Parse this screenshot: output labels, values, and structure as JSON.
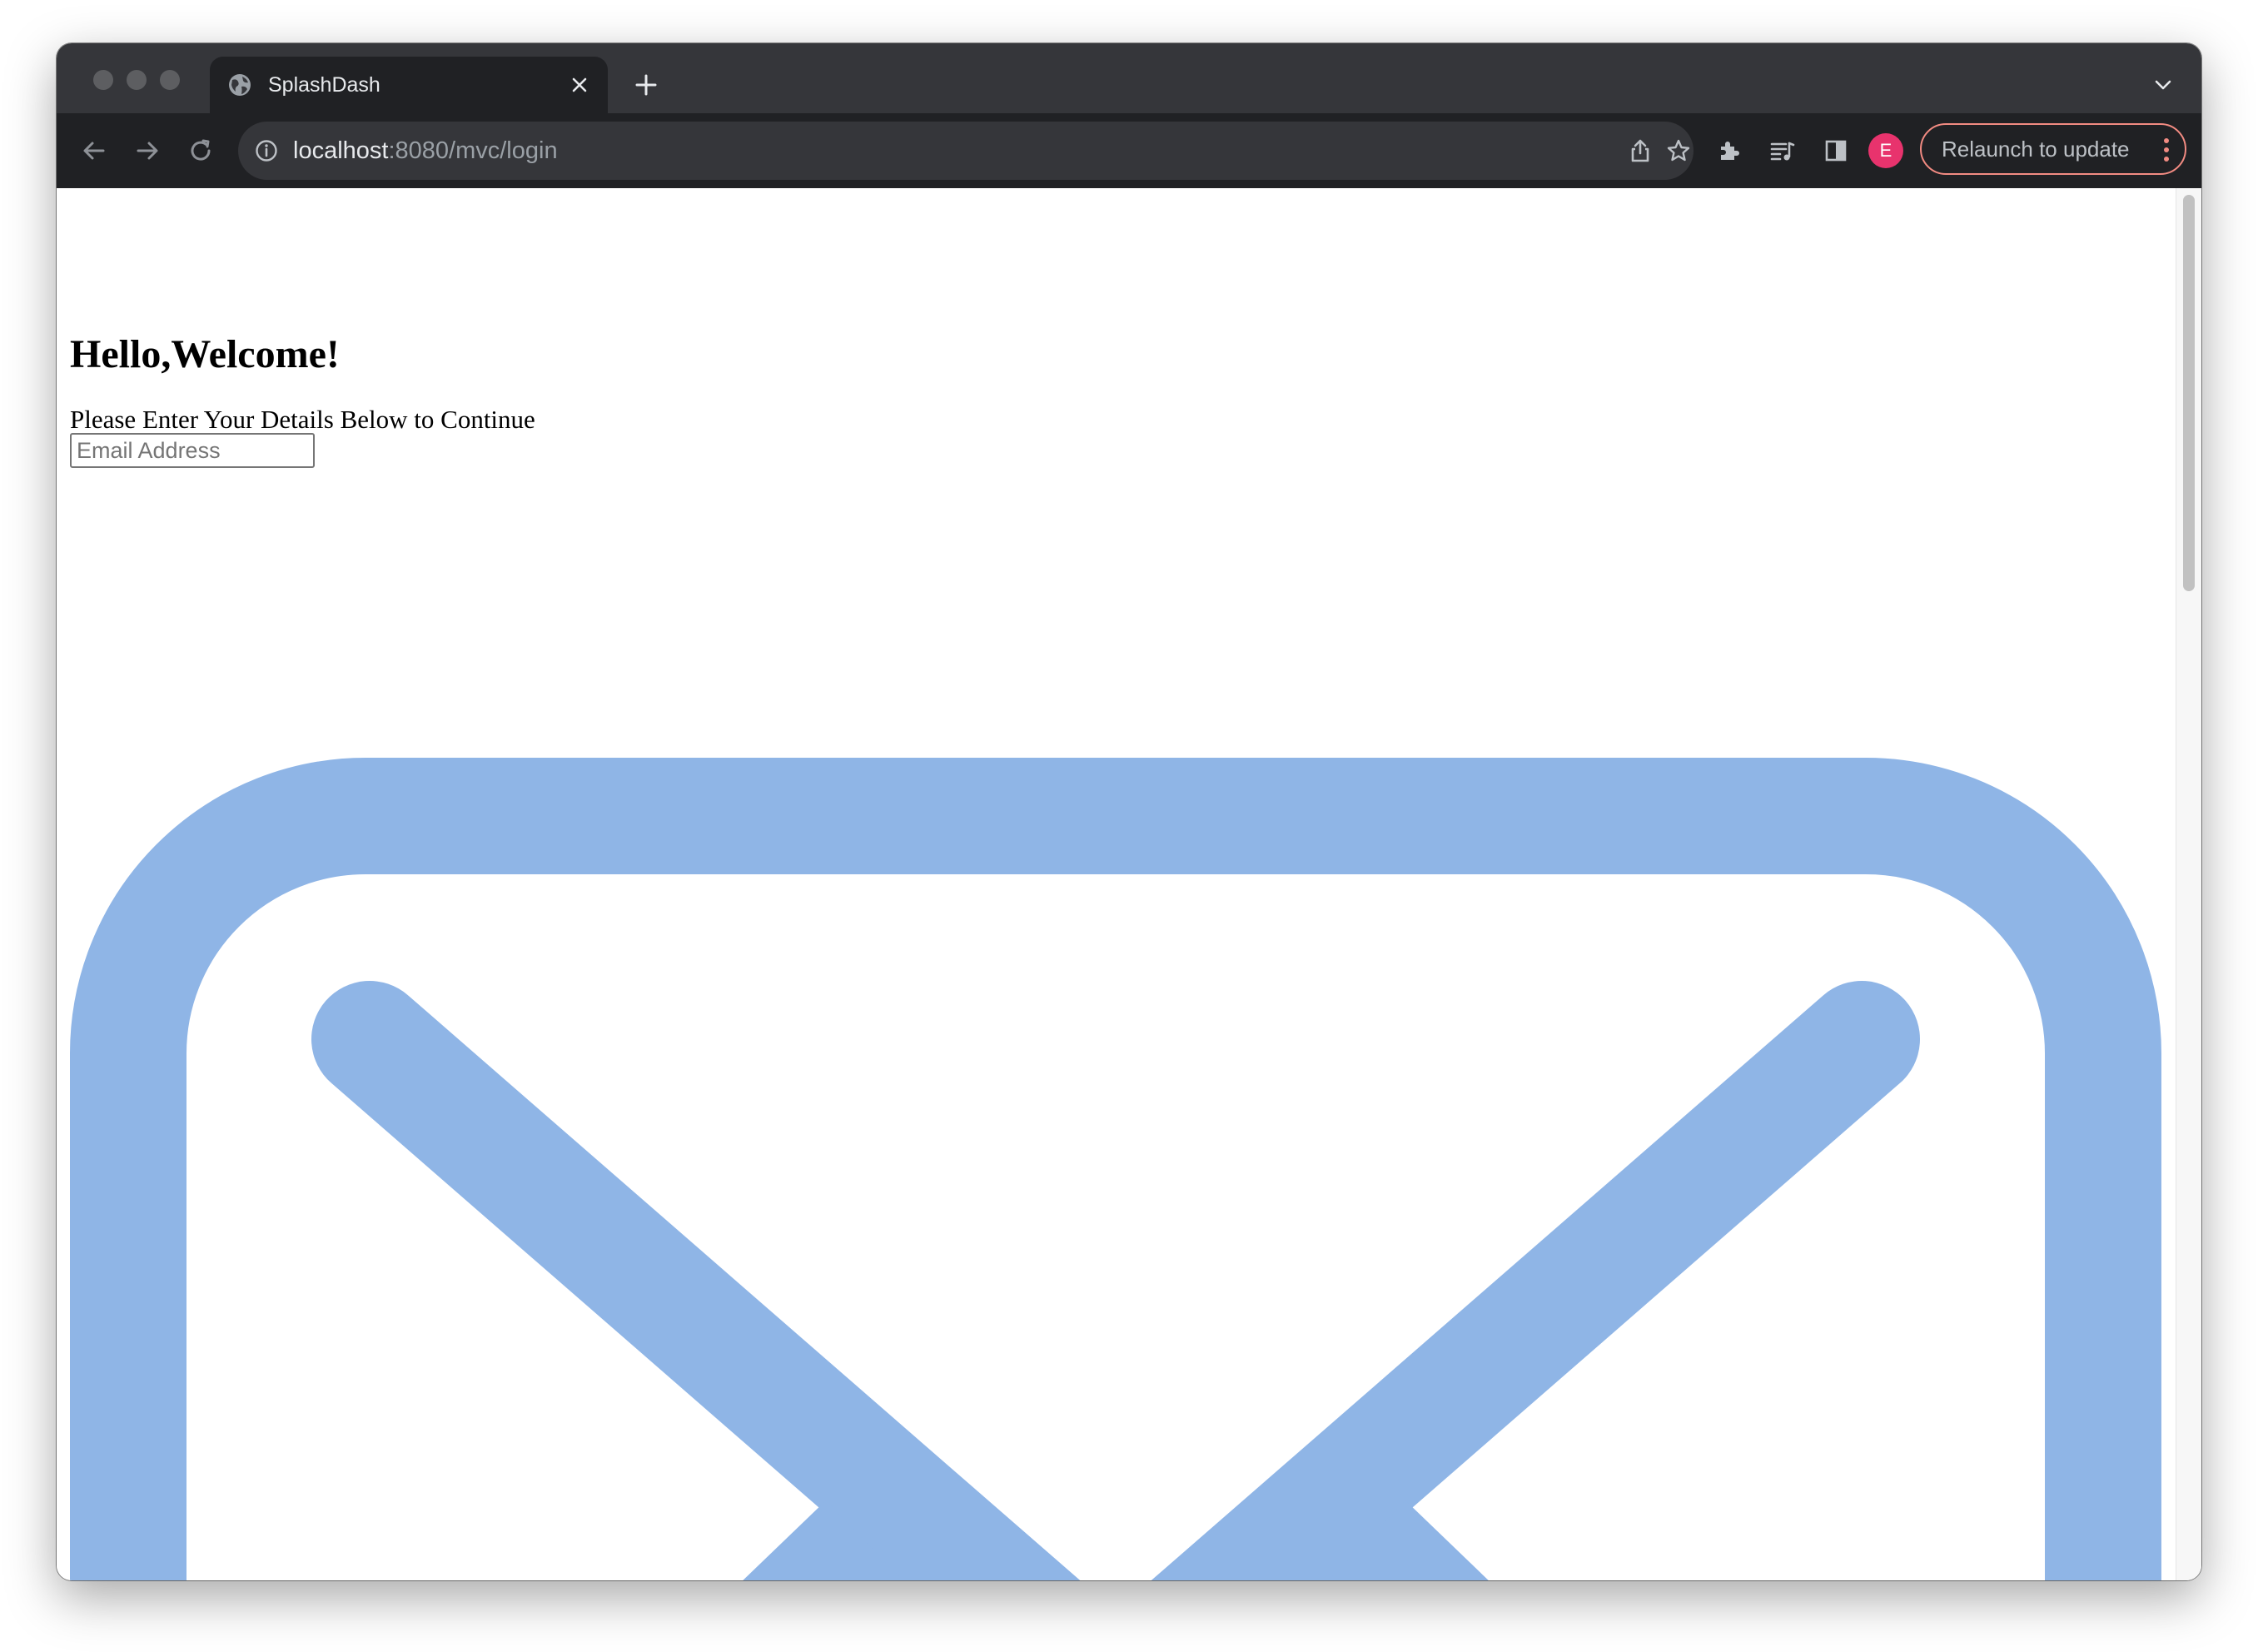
{
  "browser": {
    "tab": {
      "title": "SplashDash"
    },
    "address_bar": {
      "host": "localhost",
      "path": ":8080/mvc/login"
    },
    "profile_initial": "E",
    "relaunch_label": "Relaunch to update"
  },
  "page": {
    "heading": "Hello,Welcome!",
    "subheading": "Please Enter Your Details Below to Continue",
    "email_input": {
      "placeholder": "Email Address",
      "value": ""
    },
    "mail_icon_color": "#8fb5e6"
  },
  "colors": {
    "tabbar": "#35363a",
    "toolbar": "#202124",
    "avatar": "#e8336d",
    "relaunch_border": "#f28b82"
  }
}
